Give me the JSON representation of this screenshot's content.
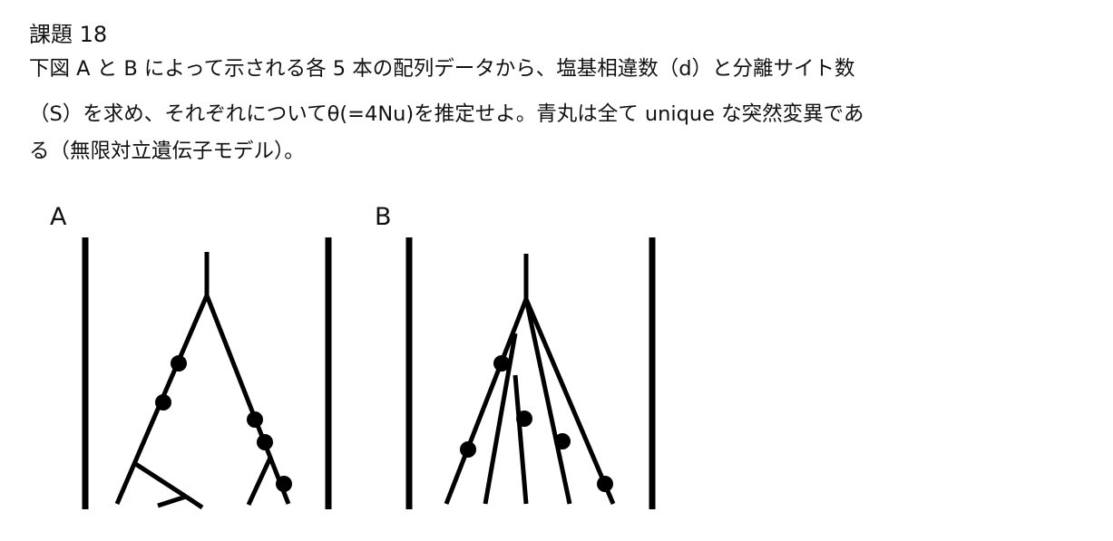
{
  "document": {
    "heading": "課題 18",
    "paragraph_lines": [
      "下図 A と B によって示される各 5 本の配列データから、塩基相違数（d）と分離サイト数",
      "（S）を求め、それぞれについてθ(=4Nu)を推定せよ。青丸は全て unique な突然変異であ",
      "る（無限対立遺伝子モデル）。"
    ]
  },
  "figure": {
    "panel_a": {
      "label": "A",
      "sequence_count": 5,
      "mutation_count": 5
    },
    "panel_b": {
      "label": "B",
      "sequence_count": 5,
      "mutation_count": 5
    }
  }
}
